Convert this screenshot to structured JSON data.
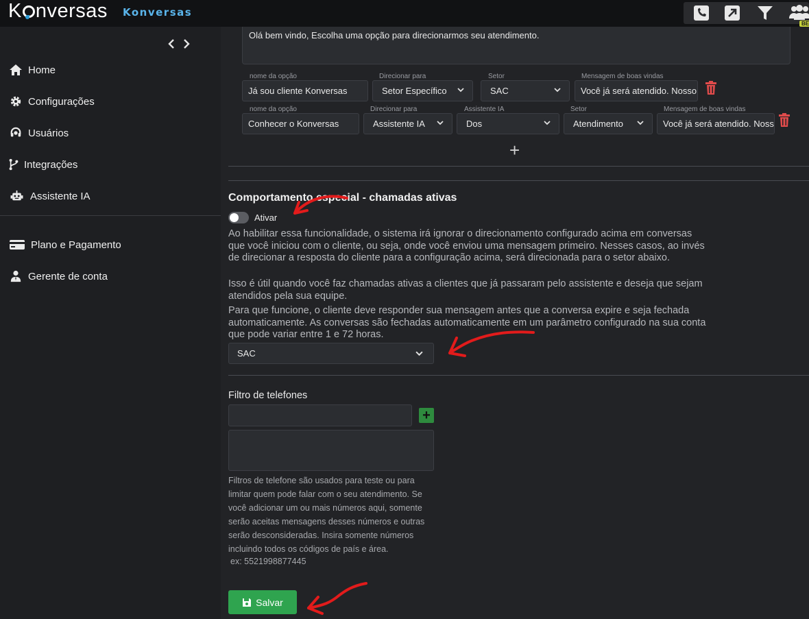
{
  "app": {
    "logo_text_before": "K",
    "logo_text_after": "nversas",
    "brand": "Konversas",
    "beta_badge": "BETA",
    "accent_color": "#5ab4ea",
    "top_icons": [
      "phone-icon",
      "external-link-icon",
      "filter-icon",
      "users-icon"
    ]
  },
  "sidebar": {
    "collapse_label": "<>",
    "items": [
      {
        "label": "Home",
        "icon": "home-icon"
      },
      {
        "label": "Configurações",
        "icon": "gear-icon"
      },
      {
        "label": "Usuários",
        "icon": "headset-icon"
      },
      {
        "label": "Integrações",
        "icon": "branch-icon"
      },
      {
        "label": "Assistente IA",
        "icon": "robot-icon"
      },
      {
        "label": "Plano e Pagamento",
        "icon": "credit-card-icon"
      },
      {
        "label": "Gerente de conta",
        "icon": "user-tie-icon"
      }
    ]
  },
  "greeting": {
    "text": "Olá bem vindo, Escolha uma opção para direcionarmos seu atendimento."
  },
  "options": [
    {
      "fields": [
        {
          "label": "nome da opção",
          "value": "Já sou cliente Konversas",
          "type": "text"
        },
        {
          "label": "Direcionar para",
          "value": "Setor Específico",
          "type": "select"
        },
        {
          "label": "Setor",
          "value": "SAC",
          "type": "select"
        },
        {
          "label": "Mensagem de boas vindas",
          "value": "Você já será atendido. Nosso",
          "type": "text"
        }
      ]
    },
    {
      "fields": [
        {
          "label": "nome da opção",
          "value": "Conhecer o Konversas",
          "type": "text"
        },
        {
          "label": "Direcionar para",
          "value": "Assistente IA",
          "type": "select"
        },
        {
          "label": "Assistente IA",
          "value": "Dos",
          "type": "select"
        },
        {
          "label": "Setor",
          "value": "Atendimento",
          "type": "select"
        },
        {
          "label": "Mensagem de boas vindas",
          "value": "Você já será atendido. Nosso",
          "type": "text"
        }
      ]
    }
  ],
  "add_option_label": "+",
  "special": {
    "title": "Comportamento especial - chamadas ativas",
    "toggle_label": "Ativar",
    "toggle_on": false,
    "desc1": "Ao habilitar essa funcionalidade, o sistema irá ignorar o direcionamento configurado acima em conversas que você iniciou com o cliente, ou seja, onde você enviou uma mensagem primeiro. Nesses casos, ao invés de direcionar a resposta do cliente para a configuração acima, será direcionada para o setor abaixo.",
    "desc2": "Isso é útil quando você faz chamadas ativas a clientes que já passaram pelo assistente e deseja que sejam atendidos pela sua equipe.",
    "desc3": "Para que funcione, o cliente deve responder sua mensagem antes que a conversa expire e seja fechada automaticamente. As conversas são fechadas automaticamente em um parâmetro configurado na sua conta que pode variar entre 1 e 72 horas.",
    "sector_value": "SAC"
  },
  "phone_filter": {
    "title": "Filtro de telefones",
    "input_value": "",
    "add_label": "+",
    "help": "Filtros de telefone são usados para teste ou para limitar quem pode falar com o seu atendimento. Se você adicionar um ou mais números aqui, somente serão aceitas mensagens desses números e outras serão desconsideradas. Insira somente números incluindo todos os códigos de país e área.",
    "example": "ex: 5521998877445"
  },
  "save": {
    "label": "Salvar",
    "color": "#2fa44f"
  }
}
